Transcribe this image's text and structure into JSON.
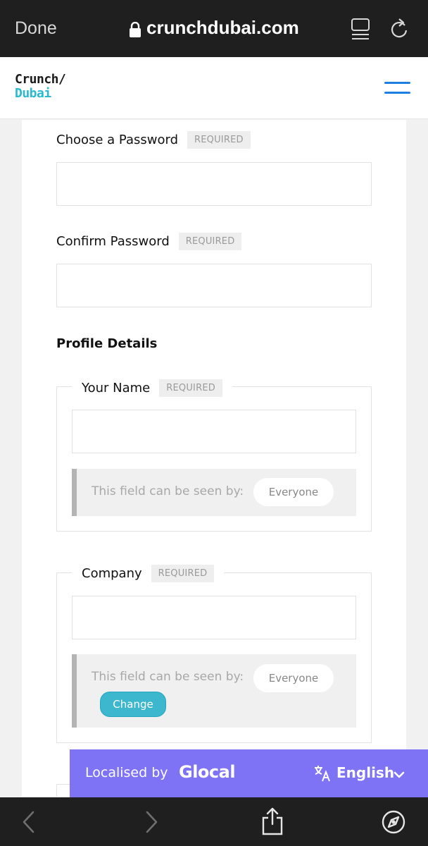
{
  "browser": {
    "done_label": "Done",
    "url": "crunchdubai.com"
  },
  "site": {
    "logo_line1": "Crunch/",
    "logo_line2": "Dubai"
  },
  "form": {
    "password": {
      "label": "Choose a Password",
      "badge": "REQUIRED"
    },
    "confirm_password": {
      "label": "Confirm Password",
      "badge": "REQUIRED"
    },
    "profile_section_title": "Profile Details",
    "your_name": {
      "label": "Your Name",
      "badge": "REQUIRED",
      "visibility_text": "This field can be seen by:",
      "visibility_value": "Everyone"
    },
    "company": {
      "label": "Company",
      "badge": "REQUIRED",
      "visibility_text": "This field can be seen by:",
      "visibility_value": "Everyone",
      "change_label": "Change"
    }
  },
  "localisation": {
    "prefix": "Localised by",
    "brand": "Glocal",
    "language": "English"
  },
  "colors": {
    "accent_cyan": "#2bb9d0",
    "hamburger_blue": "#1f7fe0",
    "localisation_bar": "#7e73f5"
  }
}
